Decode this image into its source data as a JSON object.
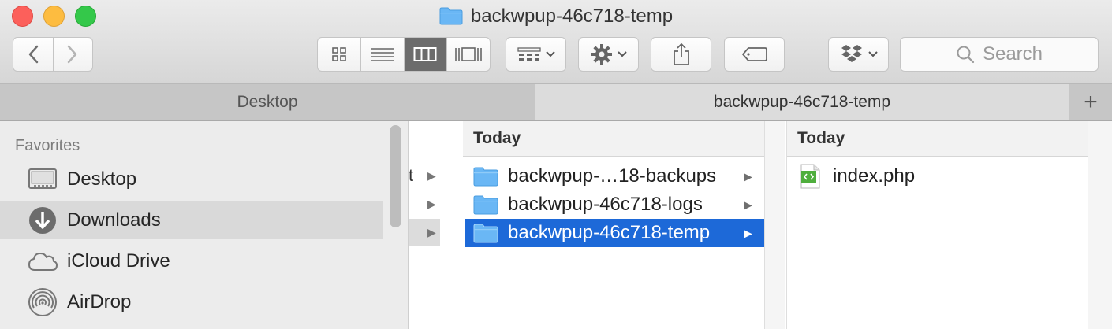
{
  "window": {
    "title": "backwpup-46c718-temp"
  },
  "toolbar": {
    "back_label": "<",
    "forward_label": ">",
    "search_placeholder": "Search"
  },
  "tabs": [
    {
      "label": "Desktop",
      "active": false
    },
    {
      "label": "backwpup-46c718-temp",
      "active": true
    }
  ],
  "tab_add_label": "+",
  "sidebar": {
    "heading": "Favorites",
    "items": [
      {
        "label": "Desktop",
        "icon": "desktop-icon",
        "selected": false
      },
      {
        "label": "Downloads",
        "icon": "downloads-icon",
        "selected": true
      },
      {
        "label": "iCloud Drive",
        "icon": "cloud-icon",
        "selected": false
      },
      {
        "label": "AirDrop",
        "icon": "airdrop-icon",
        "selected": false
      }
    ]
  },
  "column0": {
    "rows": [
      {
        "text": "t",
        "selected": false
      },
      {
        "text": "",
        "selected": false
      },
      {
        "text": "",
        "selected": true
      }
    ]
  },
  "column1": {
    "header": "Today",
    "rows": [
      {
        "label": "backwpup-…18-backups",
        "selected": false
      },
      {
        "label": "backwpup-46c718-logs",
        "selected": false
      },
      {
        "label": "backwpup-46c718-temp",
        "selected": true
      }
    ]
  },
  "column2": {
    "header": "Today",
    "rows": [
      {
        "label": "index.php",
        "icon": "php-file-icon"
      }
    ]
  },
  "colors": {
    "selection": "#1d69d8",
    "folder": "#6ab7f5"
  }
}
